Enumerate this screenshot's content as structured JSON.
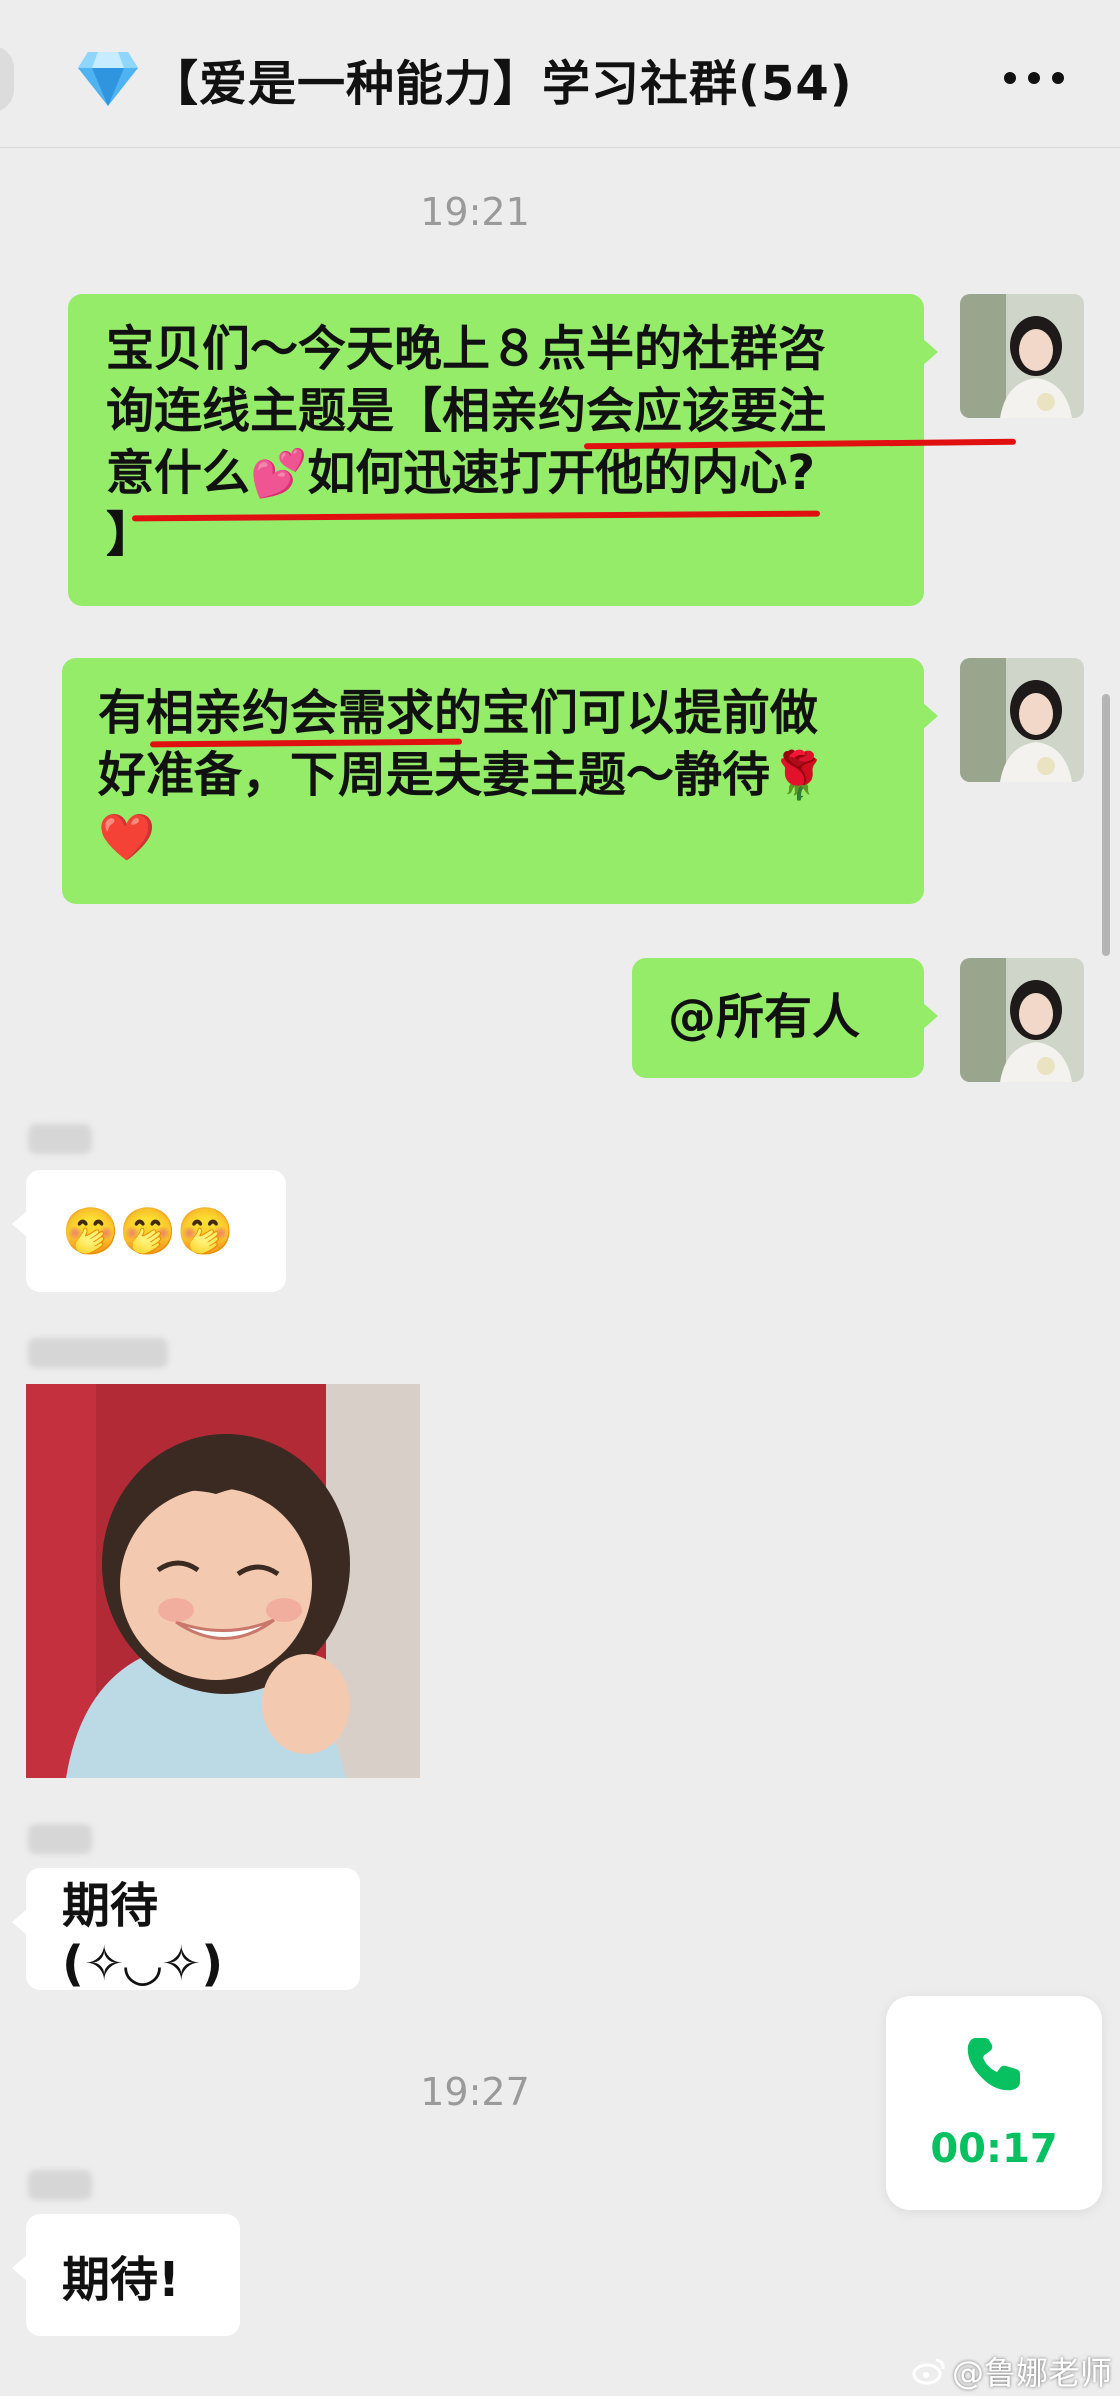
{
  "header": {
    "title": "【爱是一种能力】学习社群(54)",
    "icon": "diamond-icon",
    "more": "more-icon"
  },
  "timestamps": [
    "19:21",
    "19:27"
  ],
  "messages_out": [
    {
      "line1": "宝贝们～今天晚上８点半的社群咨",
      "line2": "询连线主题是【相亲约会应该要注",
      "line3a": "意什么",
      "line3b": "如何迅速打开他的内心?",
      "line4": "】",
      "emoji": "💕"
    },
    {
      "line1": "有相亲约会需求的宝们可以提前做",
      "line2": "好准备，下周是夫妻主题～静待",
      "emoji_rose": "🌹",
      "emoji_heart": "❤️"
    },
    {
      "text": "@所有人"
    }
  ],
  "messages_in": [
    {
      "text": "🤭🤭🤭"
    },
    {
      "type": "image",
      "description": ""
    },
    {
      "text": "期待 (✧◡✧)"
    },
    {
      "text": "期待!"
    }
  ],
  "call": {
    "time": "00:17",
    "icon": "phone-icon"
  },
  "watermark": {
    "text": "@鲁娜老师",
    "icon": "weibo-icon"
  },
  "colors": {
    "outgoing_bubble": "#95ec69",
    "incoming_bubble": "#ffffff",
    "background": "#ededed",
    "underline": "#e01010",
    "call_green": "#07c160"
  }
}
